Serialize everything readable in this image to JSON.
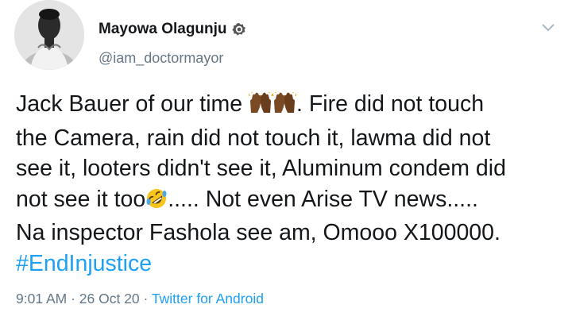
{
  "author": {
    "display_name": "Mayowa Olagunju",
    "handle": "@iam_doctormayor",
    "verified": true
  },
  "tweet": {
    "line1_a": "Jack Bauer of our time ",
    "line1_b": ". Fire did not touch",
    "line2": "the Camera, rain did not touch it, lawma did not",
    "line3": "see it, looters didn't see it, Aluminum condem did",
    "line4_a": "not see it too",
    "line4_b": "..... Not even Arise TV news.....",
    "line5": "Na inspector Fashola see am, Omooo X100000.",
    "hashtag": "#EndInjustice",
    "emojis": [
      "raising-hands-icon",
      "raising-hands-icon",
      "rolling-on-floor-laughing-icon"
    ]
  },
  "meta": {
    "time": "9:01 AM",
    "separator": " · ",
    "date": "26 Oct 20",
    "source": "Twitter for Android"
  },
  "colors": {
    "link": "#1da1f2",
    "secondary_text": "#657786",
    "primary_text": "#14171a"
  }
}
